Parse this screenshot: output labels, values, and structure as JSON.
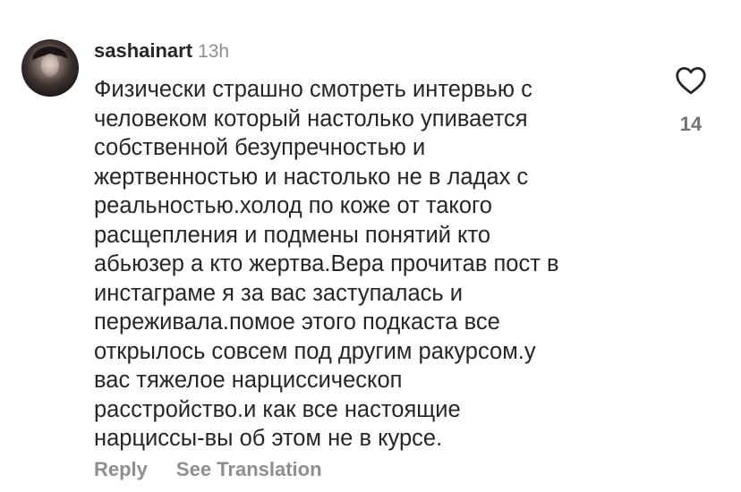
{
  "comment": {
    "username": "sashainart",
    "time": "13h",
    "text": "Физически страшно смотреть интервью с\nчеловеком который настолько упивается\nсобственной безупречностью и\nжертвенностью и настолько не в ладах с\nреальностью.холод по коже от такого\nрасщепления и подмены понятий кто\nабьюзер а кто жертва.Вера прочитав пост в\nинстаграме я за вас заступалась и\nпереживала.помое этого подкаста все\nоткрылось совсем под другим ракурсом.у\nвас тяжелое нарциссическоп\nрасстройство.и как все настоящие\nнарциссы-вы об этом не в курсе.",
    "like_icon": "heart-outline-icon",
    "like_count": "14"
  },
  "actions": {
    "reply_label": "Reply",
    "translate_label": "See Translation"
  },
  "colors": {
    "text": "#262626",
    "muted": "#8e8e8e",
    "like_count": "#737373"
  }
}
